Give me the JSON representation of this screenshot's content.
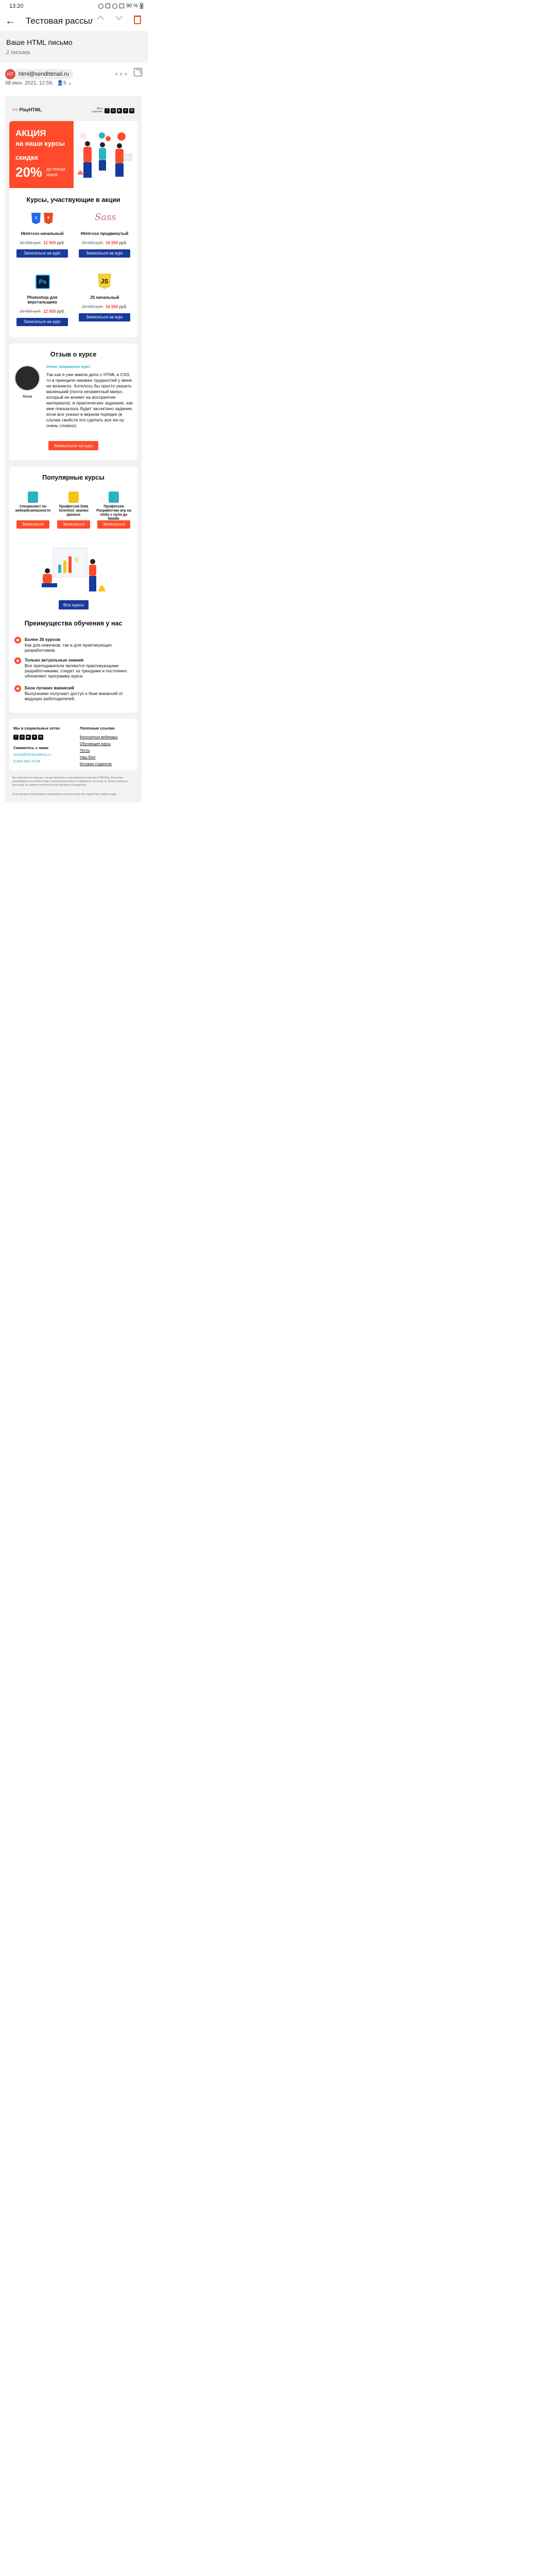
{
  "status": {
    "time": "13:20",
    "battery": "90 %"
  },
  "appbar": {
    "title": "Тестовая рассылка"
  },
  "subject": {
    "text": "Ваше HTML письмо",
    "count": "2 письма"
  },
  "sender": {
    "initials": "HT",
    "email": "html@sendhtmail.ru",
    "date": "08 июн. 2021, 12:59,",
    "recipients": "5"
  },
  "email": {
    "logo": "PlayHTML",
    "social_caption": "Мы в соцсетях:",
    "promo": {
      "line1": "АКЦИЯ",
      "line2": "на наши курсы",
      "line3": "скидка",
      "percent": "20%",
      "until": "до конца июня"
    },
    "courses_title": "Курсы, участвующие в акции",
    "courses": [
      {
        "name": "Html+css начальный",
        "old": "15 000 руб.",
        "new": "12 000",
        "cur": "руб.",
        "btn": "Записаться на курс"
      },
      {
        "name": "Html+css продвинутый",
        "old": "20 000 руб.",
        "new": "16 000",
        "cur": "руб.",
        "btn": "Записаться на курс"
      },
      {
        "name": "Photoshop для верстальщика",
        "old": "15 000 руб.",
        "new": "12 000",
        "cur": "руб.",
        "btn": "Записаться на курс"
      },
      {
        "name": "JS начальный",
        "old": "20 000 руб.",
        "new": "16 000",
        "cur": "руб.",
        "btn": "Записаться на курс"
      }
    ],
    "review": {
      "title": "Отзыв о курсе",
      "name": "Анна",
      "lead": "Очень понравился курс!",
      "text": "Так как я уже имела дело с HTML и CSS, то в принципе никаких трудностей у меня не возникло. Хотелось бы просто указать маленький (почти незаметный минус, который не влияет на восприятие материала): в практических заданиях, как мне показалось будет засчитано задание, если все указал в верном порядке (в случае свойств это сделать все же ну очень сложно).",
      "btn": "Записаться на курс"
    },
    "popular": {
      "title": "Популярные курсы",
      "items": [
        {
          "name": "Специалист по кибербезопасности",
          "btn": "Записаться"
        },
        {
          "name": "Профессия Data Scientist: анализ данных",
          "btn": "Записаться"
        },
        {
          "name": "Профессия Разработчик игр на Unity с нуля до Middle",
          "btn": "Записаться"
        }
      ],
      "all_btn": "Все курсы"
    },
    "advantages": {
      "title": "Преимущества обучения у нас",
      "items": [
        {
          "h": "Более 30 курсов",
          "d": "Как для новичков, так и для практикующих разработчиков."
        },
        {
          "h": "Только актуальные знания",
          "d": "Все преподаватели являются практикующими разработчиками, следят за трендами и постоянно обновляют программу курса."
        },
        {
          "h": "База лучших вакансий",
          "d": "Выпускники получают доступ к базе вакансий от ведущих работодателей."
        }
      ]
    },
    "footer": {
      "social_title": "Мы в социальных сетях",
      "contact_title": "Свяжитесь с нами",
      "email": "study@htmlacademy.ru",
      "phone": "8-800-690-76-68",
      "links_title": "Полезные ссылки",
      "links": [
        "Бесплатные вебинары",
        "Обучающие курсы",
        "Тесты",
        "Наш блог",
        "Истории студентов"
      ],
      "legal1": "Вы получили это письмо, так как являетесь пользователем портала HTMLPlay. Рассылка производится в соответствии с пользовательским соглашением. Если вы не хотите получать рассылку, вы можете отписаться или настроить параметры.",
      "legal2": "Если письмо отображается некорректно или вы хотите им поделиться, жмите сюда"
    }
  }
}
